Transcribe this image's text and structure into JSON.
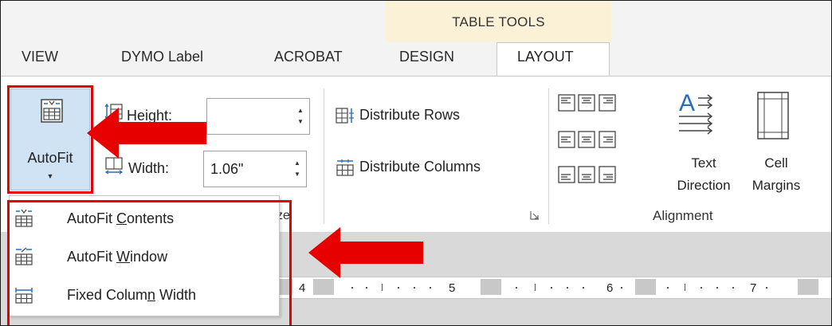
{
  "context_tab": {
    "title": "TABLE TOOLS"
  },
  "tabs": [
    {
      "label": "VIEW"
    },
    {
      "label": "DYMO Label"
    },
    {
      "label": "ACROBAT"
    },
    {
      "label": "DESIGN"
    },
    {
      "label": "LAYOUT"
    }
  ],
  "autofit": {
    "label": "AutoFit",
    "caret": "▼",
    "icon": "autofit-table-icon"
  },
  "cell_size": {
    "height_label": "Height:",
    "height_value": "",
    "width_label": "Width:",
    "width_value": "1.06\"",
    "group_label_fragment": "ze"
  },
  "distribute": {
    "rows_label": "Distribute Rows",
    "cols_label": "Distribute Columns"
  },
  "alignment": {
    "group_label": "Alignment",
    "text_direction_label": "Text\nDirection",
    "cell_margins_label": "Cell\nMargins"
  },
  "autofit_menu": [
    {
      "prefix": "AutoFit ",
      "accel": "C",
      "suffix": "ontents",
      "icon": "autofit-contents-icon"
    },
    {
      "prefix": "AutoFit ",
      "accel": "W",
      "suffix": "indow",
      "icon": "autofit-window-icon"
    },
    {
      "prefix": "Fixed Colum",
      "accel": "n",
      "suffix": " Width",
      "icon": "fixed-column-width-icon"
    }
  ],
  "ruler": {
    "numbers": [
      "4",
      "5",
      "6",
      "7"
    ]
  },
  "colors": {
    "highlight": "#e60000",
    "selected_button": "#cfe3f5",
    "context_band": "#faf1d7"
  }
}
